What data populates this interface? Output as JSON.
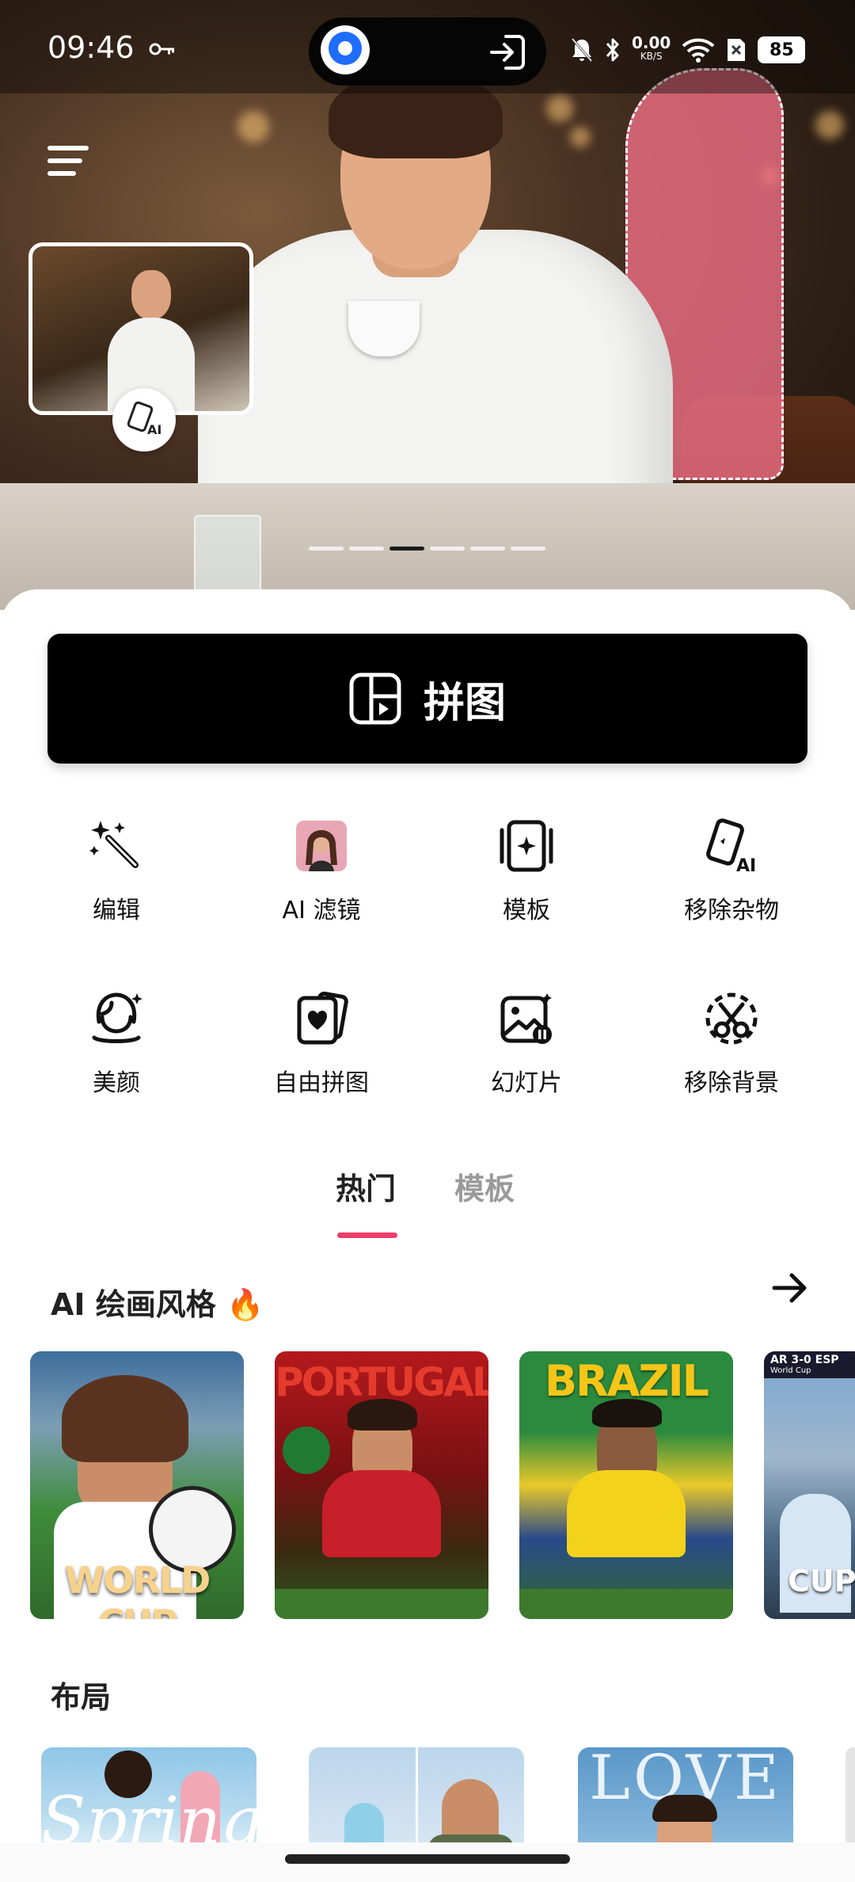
{
  "status_bar": {
    "time": "09:46",
    "net_speed_value": "0.00",
    "net_speed_unit": "KB/S",
    "battery": "85"
  },
  "hero": {
    "pager_count": 6,
    "pager_active_index": 2
  },
  "primary_action": {
    "label": "拼图",
    "icon": "collage-layout-icon"
  },
  "tools": [
    {
      "label": "编辑",
      "icon": "magic-wand-icon"
    },
    {
      "label": "AI 滤镜",
      "icon": "ai-filter-portrait-icon"
    },
    {
      "label": "模板",
      "icon": "template-card-icon"
    },
    {
      "label": "移除杂物",
      "icon": "eraser-ai-icon"
    },
    {
      "label": "美颜",
      "icon": "face-beauty-icon"
    },
    {
      "label": "自由拼图",
      "icon": "free-collage-heart-icon"
    },
    {
      "label": "幻灯片",
      "icon": "slideshow-icon"
    },
    {
      "label": "移除背景",
      "icon": "remove-background-scissors-icon"
    }
  ],
  "content_tabs": {
    "hot": "热门",
    "templates": "模板",
    "active": "hot",
    "accent_color": "#ef3e6b"
  },
  "ai_painting_section": {
    "title": "AI 绘画风格",
    "title_emoji": "🔥",
    "cards": [
      {
        "caption": "WORLD CUP",
        "icon": "world-cup-fan-image"
      },
      {
        "caption": "PORTUGAL",
        "icon": "portugal-player-image"
      },
      {
        "caption": "BRAZIL",
        "icon": "brazil-player-image"
      },
      {
        "caption": "CUP",
        "score": "AR 3-0 ESP",
        "sub": "World Cup",
        "icon": "argentina-fans-image"
      }
    ]
  },
  "layout_section": {
    "title": "布局",
    "cards": [
      {
        "caption": "Spring"
      },
      {
        "caption": ""
      },
      {
        "caption": "LOVE"
      }
    ]
  }
}
